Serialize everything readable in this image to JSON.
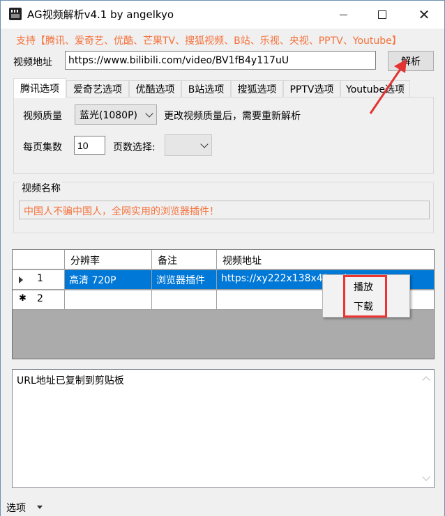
{
  "window": {
    "title": "AG视频解析v4.1 by angelkyo"
  },
  "support_text": "支持【腾讯、爱奇艺、优酷、芒果TV、搜狐视频、B站、乐视、央视、PPTV、Youtube】",
  "url": {
    "label": "视频地址",
    "value": "https://www.bilibili.com/video/BV1fB4y117uU"
  },
  "parse_button": "解析",
  "tabs": [
    {
      "label": "腾讯选项"
    },
    {
      "label": "爱奇艺选项"
    },
    {
      "label": "优酷选项"
    },
    {
      "label": "B站选项"
    },
    {
      "label": "搜狐选项"
    },
    {
      "label": "PPTV选项"
    },
    {
      "label": "Youtube选项"
    }
  ],
  "quality": {
    "label": "视频质量",
    "selected": "蓝光(1080P)",
    "hint": "更改视频质量后，需要重新解析"
  },
  "page": {
    "per_page_label": "每页集数",
    "per_page_value": "10",
    "page_select_label": "页数选择:",
    "page_select_value": ""
  },
  "video_name": {
    "group_label": "视频名称",
    "value": "中国人不骗中国人，全网实用的浏览器插件！"
  },
  "grid": {
    "headers": [
      "",
      "分辨率",
      "备注",
      "视频地址"
    ],
    "rows": [
      {
        "num": "1",
        "resolution": "高清 720P",
        "note": "浏览器插件",
        "url": "https://xy222x138x43...vi..."
      },
      {
        "num": "2",
        "resolution": "",
        "note": "",
        "url": ""
      }
    ]
  },
  "context_menu": {
    "items": [
      "播放",
      "下载"
    ]
  },
  "log": {
    "text": "URL地址已复制到剪贴板"
  },
  "status": {
    "options_label": "选项"
  },
  "colors": {
    "accent": "#f5713a",
    "selection": "#0078d7",
    "annotation": "#e33333"
  }
}
